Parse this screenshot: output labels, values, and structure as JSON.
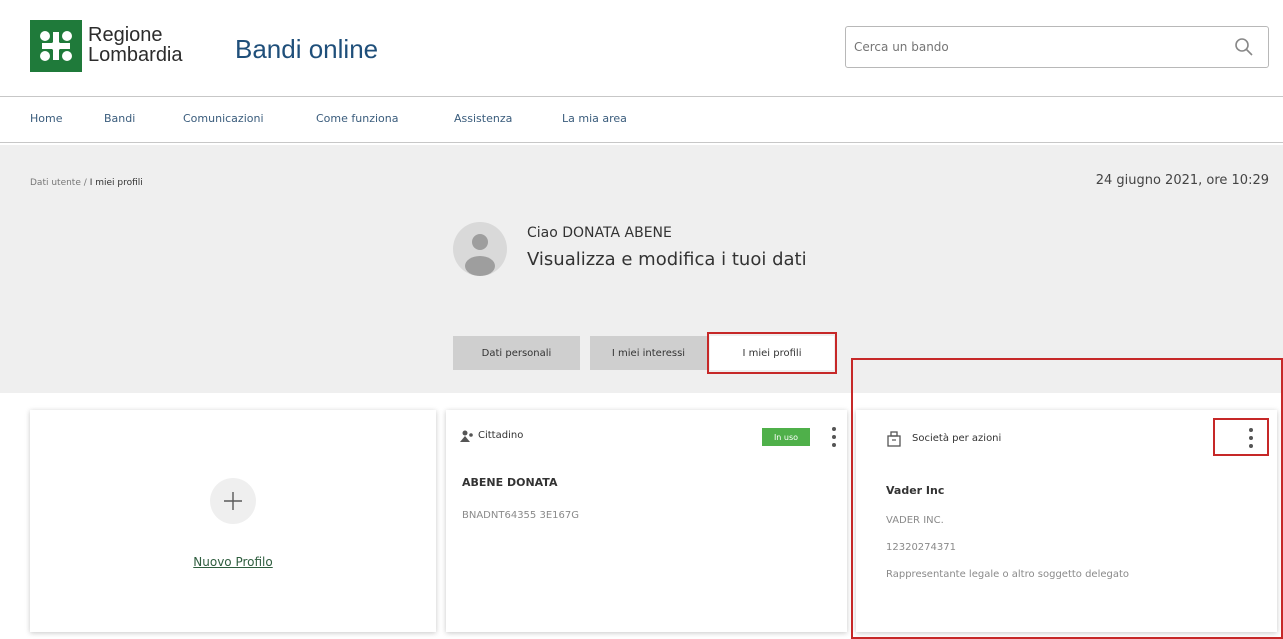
{
  "header": {
    "brand_line1": "Regione",
    "brand_line2": "Lombardia",
    "app_title": "Bandi online",
    "search_placeholder": "Cerca un bando"
  },
  "nav": {
    "items": [
      {
        "label": "Home"
      },
      {
        "label": "Bandi"
      },
      {
        "label": "Comunicazioni"
      },
      {
        "label": "Come funziona"
      },
      {
        "label": "Assistenza"
      },
      {
        "label": "La mia area"
      }
    ]
  },
  "page": {
    "breadcrumb_parent": "Dati utente",
    "breadcrumb_sep": "/",
    "breadcrumb_current": "I miei profili",
    "datetime": "24 giugno 2021, ore 10:29",
    "greeting": "Ciao DONATA ABENE",
    "subtitle": "Visualizza e modifica i tuoi dati"
  },
  "tabs": [
    {
      "label": "Dati personali"
    },
    {
      "label": "I miei interessi"
    },
    {
      "label": "I miei profili"
    }
  ],
  "cards": {
    "new_profile": {
      "label": "Nuovo Profilo"
    },
    "citizen": {
      "type": "Cittadino",
      "badge": "In uso",
      "name": "ABENE DONATA",
      "code": "BNADNT64355 3E167G"
    },
    "company": {
      "type": "Società per azioni",
      "name": "Vader Inc",
      "line1": "VADER INC.",
      "line2": "12320274371",
      "line3": "Rappresentante legale o altro soggetto delegato"
    }
  },
  "colors": {
    "brand_green": "#1f7a3a",
    "title_blue": "#1f4f7a",
    "badge_green": "#4fb04a",
    "highlight_red": "#c62828"
  }
}
